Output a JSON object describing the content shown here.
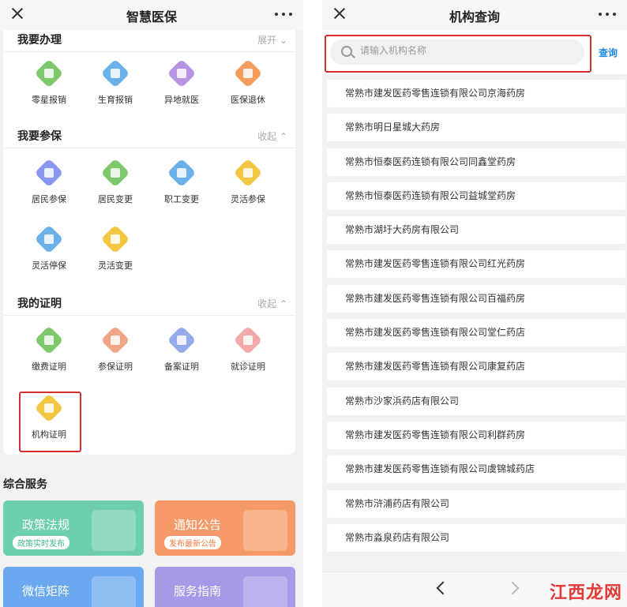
{
  "left": {
    "title": "智慧医保",
    "sections": [
      {
        "title": "我要办理",
        "toggle": "展开 ⌄",
        "items": [
          {
            "label": "零星报销",
            "color": "#6ec35c"
          },
          {
            "label": "生育报销",
            "color": "#5aa9e8"
          },
          {
            "label": "异地就医",
            "color": "#b088e0"
          },
          {
            "label": "医保退休",
            "color": "#f2924a"
          }
        ]
      },
      {
        "title": "我要参保",
        "toggle": "收起 ⌃",
        "items": [
          {
            "label": "居民参保",
            "color": "#7e8cf0"
          },
          {
            "label": "居民变更",
            "color": "#6ec35c"
          },
          {
            "label": "职工变更",
            "color": "#5aa9e8"
          },
          {
            "label": "灵活参保",
            "color": "#f2c12e"
          },
          {
            "label": "灵活停保",
            "color": "#5aa9e8"
          },
          {
            "label": "灵活变更",
            "color": "#f2c12e"
          }
        ]
      },
      {
        "title": "我的证明",
        "toggle": "收起 ⌃",
        "items": [
          {
            "label": "缴费证明",
            "color": "#6ec35c"
          },
          {
            "label": "参保证明",
            "color": "#f09a7a"
          },
          {
            "label": "备案证明",
            "color": "#8aa3e8"
          },
          {
            "label": "就诊证明",
            "color": "#f0a0a0"
          },
          {
            "label": "机构证明",
            "color": "#f2c12e"
          }
        ]
      }
    ],
    "services_title": "综合服务",
    "services": [
      {
        "title": "政策法规",
        "sub": "政策实时发布",
        "color": "#6dcfae",
        "sub_color": "#3bb58c"
      },
      {
        "title": "通知公告",
        "sub": "发布最新公告",
        "color": "#f79a6a",
        "sub_color": "#f07a3a"
      },
      {
        "title": "微信矩阵",
        "sub": "",
        "color": "#6aa8f0",
        "sub_color": "#3b82d8"
      },
      {
        "title": "服务指南",
        "sub": "",
        "color": "#a898e8",
        "sub_color": "#7e6cd8"
      }
    ]
  },
  "right": {
    "title": "机构查询",
    "search": {
      "placeholder": "请输入机构名称",
      "button": "查询"
    },
    "results": [
      "常熟市建发医药零售连锁有限公司京海药房",
      "常熟市明日星城大药房",
      "常熟市恒泰医药连锁有限公司同鑫堂药房",
      "常熟市恒泰医药连锁有限公司益城堂药房",
      "常熟市湖圩大药房有限公司",
      "常熟市建发医药零售连锁有限公司红光药房",
      "常熟市建发医药零售连锁有限公司百福药房",
      "常熟市建发医药零售连锁有限公司堂仁药店",
      "常熟市建发医药零售连锁有限公司康复药店",
      "常熟市沙家浜药店有限公司",
      "常熟市建发医药零售连锁有限公司利群药房",
      "常熟市建发医药零售连锁有限公司虞锦城药店",
      "常熟市浒浦药店有限公司",
      "常熟市淼泉药店有限公司"
    ],
    "watermark": "江西龙网"
  }
}
